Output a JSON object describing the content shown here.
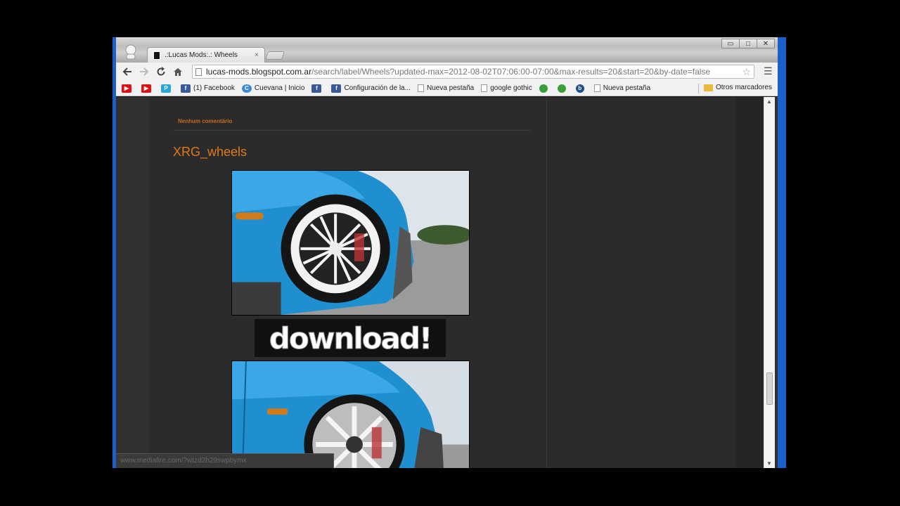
{
  "browser": {
    "tab_title": ".:Lucas Mods:.: Wheels",
    "tab_close": "×",
    "url_host": "lucas-mods.blogspot.com.ar",
    "url_path": "/search/label/Wheels?updated-max=2012-08-02T07:06:00-07:00&max-results=20&start=20&by-date=false",
    "controls": {
      "minimize": "▭",
      "maximize": "□",
      "close": "✕"
    }
  },
  "bookmarks": [
    {
      "label": "",
      "icon": "youtube-icon"
    },
    {
      "label": "",
      "icon": "youtube-icon"
    },
    {
      "label": "",
      "icon": "p-icon"
    },
    {
      "label": "(1) Facebook",
      "icon": "facebook-icon"
    },
    {
      "label": "Cuevana | Inicio",
      "icon": "cuevana-icon"
    },
    {
      "label": "",
      "icon": "facebook-icon"
    },
    {
      "label": "Configuración de la...",
      "icon": "facebook-icon"
    },
    {
      "label": "Nueva pestaña",
      "icon": "page-icon"
    },
    {
      "label": "google gothic",
      "icon": "page-icon"
    },
    {
      "label": "",
      "icon": "green-icon"
    },
    {
      "label": "",
      "icon": "green-icon"
    },
    {
      "label": "",
      "icon": "b-icon"
    },
    {
      "label": "Nueva pestaña",
      "icon": "page-icon"
    }
  ],
  "other_bookmarks": "Otros marcadores",
  "post": {
    "comment_link": "Nenhum comentário",
    "title": "XRG_wheels",
    "download_label": "download!"
  },
  "status_url": "www.mediafire.com/?wtzd2h29swpbymx",
  "colors": {
    "accent_orange": "#e07a18",
    "page_bg": "#2b2b2b",
    "car_blue": "#1f8fd0"
  }
}
